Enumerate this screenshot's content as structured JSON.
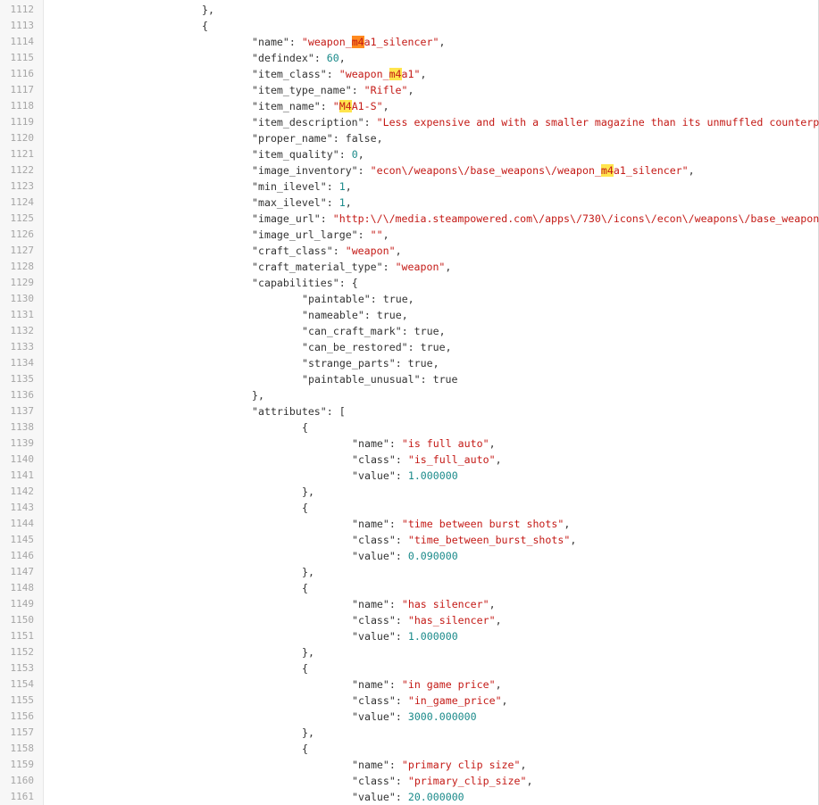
{
  "lines": [
    {
      "n": "1112",
      "indent": 4,
      "tokens": [
        {
          "t": "p",
          "v": "},"
        }
      ]
    },
    {
      "n": "1113",
      "indent": 4,
      "tokens": [
        {
          "t": "p",
          "v": "{"
        }
      ]
    },
    {
      "n": "1114",
      "indent": 5,
      "tokens": [
        {
          "t": "k",
          "v": "\"name\""
        },
        {
          "t": "p",
          "v": ": "
        },
        {
          "t": "s",
          "v": "\"weapon_"
        },
        {
          "t": "ha",
          "v": "m4"
        },
        {
          "t": "s",
          "v": "a1_silencer\""
        },
        {
          "t": "p",
          "v": ","
        }
      ]
    },
    {
      "n": "1115",
      "indent": 5,
      "tokens": [
        {
          "t": "k",
          "v": "\"defindex\""
        },
        {
          "t": "p",
          "v": ": "
        },
        {
          "t": "n",
          "v": "60"
        },
        {
          "t": "p",
          "v": ","
        }
      ]
    },
    {
      "n": "1116",
      "indent": 5,
      "tokens": [
        {
          "t": "k",
          "v": "\"item_class\""
        },
        {
          "t": "p",
          "v": ": "
        },
        {
          "t": "s",
          "v": "\"weapon_"
        },
        {
          "t": "h",
          "v": "m4"
        },
        {
          "t": "s",
          "v": "a1\""
        },
        {
          "t": "p",
          "v": ","
        }
      ]
    },
    {
      "n": "1117",
      "indent": 5,
      "tokens": [
        {
          "t": "k",
          "v": "\"item_type_name\""
        },
        {
          "t": "p",
          "v": ": "
        },
        {
          "t": "s",
          "v": "\"Rifle\""
        },
        {
          "t": "p",
          "v": ","
        }
      ]
    },
    {
      "n": "1118",
      "indent": 5,
      "tokens": [
        {
          "t": "k",
          "v": "\"item_name\""
        },
        {
          "t": "p",
          "v": ": "
        },
        {
          "t": "s",
          "v": "\""
        },
        {
          "t": "h",
          "v": "M4"
        },
        {
          "t": "s",
          "v": "A1-S\""
        },
        {
          "t": "p",
          "v": ","
        }
      ]
    },
    {
      "n": "1119",
      "indent": 5,
      "tokens": [
        {
          "t": "k",
          "v": "\"item_description\""
        },
        {
          "t": "p",
          "v": ": "
        },
        {
          "t": "s",
          "v": "\"Less expensive and with a smaller magazine than its unmuffled counterpart"
        }
      ]
    },
    {
      "n": "1120",
      "indent": 5,
      "tokens": [
        {
          "t": "k",
          "v": "\"proper_name\""
        },
        {
          "t": "p",
          "v": ": "
        },
        {
          "t": "w",
          "v": "false"
        },
        {
          "t": "p",
          "v": ","
        }
      ]
    },
    {
      "n": "1121",
      "indent": 5,
      "tokens": [
        {
          "t": "k",
          "v": "\"item_quality\""
        },
        {
          "t": "p",
          "v": ": "
        },
        {
          "t": "n",
          "v": "0"
        },
        {
          "t": "p",
          "v": ","
        }
      ]
    },
    {
      "n": "1122",
      "indent": 5,
      "tokens": [
        {
          "t": "k",
          "v": "\"image_inventory\""
        },
        {
          "t": "p",
          "v": ": "
        },
        {
          "t": "s",
          "v": "\"econ\\/weapons\\/base_weapons\\/weapon_"
        },
        {
          "t": "h",
          "v": "m4"
        },
        {
          "t": "s",
          "v": "a1_silencer\""
        },
        {
          "t": "p",
          "v": ","
        }
      ]
    },
    {
      "n": "1123",
      "indent": 5,
      "tokens": [
        {
          "t": "k",
          "v": "\"min_ilevel\""
        },
        {
          "t": "p",
          "v": ": "
        },
        {
          "t": "n",
          "v": "1"
        },
        {
          "t": "p",
          "v": ","
        }
      ]
    },
    {
      "n": "1124",
      "indent": 5,
      "tokens": [
        {
          "t": "k",
          "v": "\"max_ilevel\""
        },
        {
          "t": "p",
          "v": ": "
        },
        {
          "t": "n",
          "v": "1"
        },
        {
          "t": "p",
          "v": ","
        }
      ]
    },
    {
      "n": "1125",
      "indent": 5,
      "tokens": [
        {
          "t": "k",
          "v": "\"image_url\""
        },
        {
          "t": "p",
          "v": ": "
        },
        {
          "t": "s",
          "v": "\"http:\\/\\/media.steampowered.com\\/apps\\/730\\/icons\\/econ\\/weapons\\/base_weapons"
        }
      ]
    },
    {
      "n": "1126",
      "indent": 5,
      "tokens": [
        {
          "t": "k",
          "v": "\"image_url_large\""
        },
        {
          "t": "p",
          "v": ": "
        },
        {
          "t": "s",
          "v": "\"\""
        },
        {
          "t": "p",
          "v": ","
        }
      ]
    },
    {
      "n": "1127",
      "indent": 5,
      "tokens": [
        {
          "t": "k",
          "v": "\"craft_class\""
        },
        {
          "t": "p",
          "v": ": "
        },
        {
          "t": "s",
          "v": "\"weapon\""
        },
        {
          "t": "p",
          "v": ","
        }
      ]
    },
    {
      "n": "1128",
      "indent": 5,
      "tokens": [
        {
          "t": "k",
          "v": "\"craft_material_type\""
        },
        {
          "t": "p",
          "v": ": "
        },
        {
          "t": "s",
          "v": "\"weapon\""
        },
        {
          "t": "p",
          "v": ","
        }
      ]
    },
    {
      "n": "1129",
      "indent": 5,
      "tokens": [
        {
          "t": "k",
          "v": "\"capabilities\""
        },
        {
          "t": "p",
          "v": ": {"
        }
      ]
    },
    {
      "n": "1130",
      "indent": 6,
      "tokens": [
        {
          "t": "k",
          "v": "\"paintable\""
        },
        {
          "t": "p",
          "v": ": "
        },
        {
          "t": "w",
          "v": "true"
        },
        {
          "t": "p",
          "v": ","
        }
      ]
    },
    {
      "n": "1131",
      "indent": 6,
      "tokens": [
        {
          "t": "k",
          "v": "\"nameable\""
        },
        {
          "t": "p",
          "v": ": "
        },
        {
          "t": "w",
          "v": "true"
        },
        {
          "t": "p",
          "v": ","
        }
      ]
    },
    {
      "n": "1132",
      "indent": 6,
      "tokens": [
        {
          "t": "k",
          "v": "\"can_craft_mark\""
        },
        {
          "t": "p",
          "v": ": "
        },
        {
          "t": "w",
          "v": "true"
        },
        {
          "t": "p",
          "v": ","
        }
      ]
    },
    {
      "n": "1133",
      "indent": 6,
      "tokens": [
        {
          "t": "k",
          "v": "\"can_be_restored\""
        },
        {
          "t": "p",
          "v": ": "
        },
        {
          "t": "w",
          "v": "true"
        },
        {
          "t": "p",
          "v": ","
        }
      ]
    },
    {
      "n": "1134",
      "indent": 6,
      "tokens": [
        {
          "t": "k",
          "v": "\"strange_parts\""
        },
        {
          "t": "p",
          "v": ": "
        },
        {
          "t": "w",
          "v": "true"
        },
        {
          "t": "p",
          "v": ","
        }
      ]
    },
    {
      "n": "1135",
      "indent": 6,
      "tokens": [
        {
          "t": "k",
          "v": "\"paintable_unusual\""
        },
        {
          "t": "p",
          "v": ": "
        },
        {
          "t": "w",
          "v": "true"
        }
      ]
    },
    {
      "n": "1136",
      "indent": 5,
      "tokens": [
        {
          "t": "p",
          "v": "},"
        }
      ]
    },
    {
      "n": "1137",
      "indent": 5,
      "tokens": [
        {
          "t": "k",
          "v": "\"attributes\""
        },
        {
          "t": "p",
          "v": ": ["
        }
      ]
    },
    {
      "n": "1138",
      "indent": 6,
      "tokens": [
        {
          "t": "p",
          "v": "{"
        }
      ]
    },
    {
      "n": "1139",
      "indent": 7,
      "tokens": [
        {
          "t": "k",
          "v": "\"name\""
        },
        {
          "t": "p",
          "v": ": "
        },
        {
          "t": "s",
          "v": "\"is full auto\""
        },
        {
          "t": "p",
          "v": ","
        }
      ]
    },
    {
      "n": "1140",
      "indent": 7,
      "tokens": [
        {
          "t": "k",
          "v": "\"class\""
        },
        {
          "t": "p",
          "v": ": "
        },
        {
          "t": "s",
          "v": "\"is_full_auto\""
        },
        {
          "t": "p",
          "v": ","
        }
      ]
    },
    {
      "n": "1141",
      "indent": 7,
      "tokens": [
        {
          "t": "k",
          "v": "\"value\""
        },
        {
          "t": "p",
          "v": ": "
        },
        {
          "t": "n",
          "v": "1.000000"
        }
      ]
    },
    {
      "n": "1142",
      "indent": 6,
      "tokens": [
        {
          "t": "p",
          "v": "},"
        }
      ]
    },
    {
      "n": "1143",
      "indent": 6,
      "tokens": [
        {
          "t": "p",
          "v": "{"
        }
      ]
    },
    {
      "n": "1144",
      "indent": 7,
      "tokens": [
        {
          "t": "k",
          "v": "\"name\""
        },
        {
          "t": "p",
          "v": ": "
        },
        {
          "t": "s",
          "v": "\"time between burst shots\""
        },
        {
          "t": "p",
          "v": ","
        }
      ]
    },
    {
      "n": "1145",
      "indent": 7,
      "tokens": [
        {
          "t": "k",
          "v": "\"class\""
        },
        {
          "t": "p",
          "v": ": "
        },
        {
          "t": "s",
          "v": "\"time_between_burst_shots\""
        },
        {
          "t": "p",
          "v": ","
        }
      ]
    },
    {
      "n": "1146",
      "indent": 7,
      "tokens": [
        {
          "t": "k",
          "v": "\"value\""
        },
        {
          "t": "p",
          "v": ": "
        },
        {
          "t": "n",
          "v": "0.090000"
        }
      ]
    },
    {
      "n": "1147",
      "indent": 6,
      "tokens": [
        {
          "t": "p",
          "v": "},"
        }
      ]
    },
    {
      "n": "1148",
      "indent": 6,
      "tokens": [
        {
          "t": "p",
          "v": "{"
        }
      ]
    },
    {
      "n": "1149",
      "indent": 7,
      "tokens": [
        {
          "t": "k",
          "v": "\"name\""
        },
        {
          "t": "p",
          "v": ": "
        },
        {
          "t": "s",
          "v": "\"has silencer\""
        },
        {
          "t": "p",
          "v": ","
        }
      ]
    },
    {
      "n": "1150",
      "indent": 7,
      "tokens": [
        {
          "t": "k",
          "v": "\"class\""
        },
        {
          "t": "p",
          "v": ": "
        },
        {
          "t": "s",
          "v": "\"has_silencer\""
        },
        {
          "t": "p",
          "v": ","
        }
      ]
    },
    {
      "n": "1151",
      "indent": 7,
      "tokens": [
        {
          "t": "k",
          "v": "\"value\""
        },
        {
          "t": "p",
          "v": ": "
        },
        {
          "t": "n",
          "v": "1.000000"
        }
      ]
    },
    {
      "n": "1152",
      "indent": 6,
      "tokens": [
        {
          "t": "p",
          "v": "},"
        }
      ]
    },
    {
      "n": "1153",
      "indent": 6,
      "tokens": [
        {
          "t": "p",
          "v": "{"
        }
      ]
    },
    {
      "n": "1154",
      "indent": 7,
      "tokens": [
        {
          "t": "k",
          "v": "\"name\""
        },
        {
          "t": "p",
          "v": ": "
        },
        {
          "t": "s",
          "v": "\"in game price\""
        },
        {
          "t": "p",
          "v": ","
        }
      ]
    },
    {
      "n": "1155",
      "indent": 7,
      "tokens": [
        {
          "t": "k",
          "v": "\"class\""
        },
        {
          "t": "p",
          "v": ": "
        },
        {
          "t": "s",
          "v": "\"in_game_price\""
        },
        {
          "t": "p",
          "v": ","
        }
      ]
    },
    {
      "n": "1156",
      "indent": 7,
      "tokens": [
        {
          "t": "k",
          "v": "\"value\""
        },
        {
          "t": "p",
          "v": ": "
        },
        {
          "t": "n",
          "v": "3000.000000"
        }
      ]
    },
    {
      "n": "1157",
      "indent": 6,
      "tokens": [
        {
          "t": "p",
          "v": "},"
        }
      ]
    },
    {
      "n": "1158",
      "indent": 6,
      "tokens": [
        {
          "t": "p",
          "v": "{"
        }
      ]
    },
    {
      "n": "1159",
      "indent": 7,
      "tokens": [
        {
          "t": "k",
          "v": "\"name\""
        },
        {
          "t": "p",
          "v": ": "
        },
        {
          "t": "s",
          "v": "\"primary clip size\""
        },
        {
          "t": "p",
          "v": ","
        }
      ]
    },
    {
      "n": "1160",
      "indent": 7,
      "tokens": [
        {
          "t": "k",
          "v": "\"class\""
        },
        {
          "t": "p",
          "v": ": "
        },
        {
          "t": "s",
          "v": "\"primary_clip_size\""
        },
        {
          "t": "p",
          "v": ","
        }
      ]
    },
    {
      "n": "1161",
      "indent": 7,
      "tokens": [
        {
          "t": "k",
          "v": "\"value\""
        },
        {
          "t": "p",
          "v": ": "
        },
        {
          "t": "n",
          "v": "20.000000"
        }
      ]
    }
  ],
  "colors": {
    "key": "#333333",
    "string": "#c41a16",
    "number": "#1a8a8a",
    "search_match": "#ffe54d",
    "search_match_active": "#ff8a1f"
  }
}
